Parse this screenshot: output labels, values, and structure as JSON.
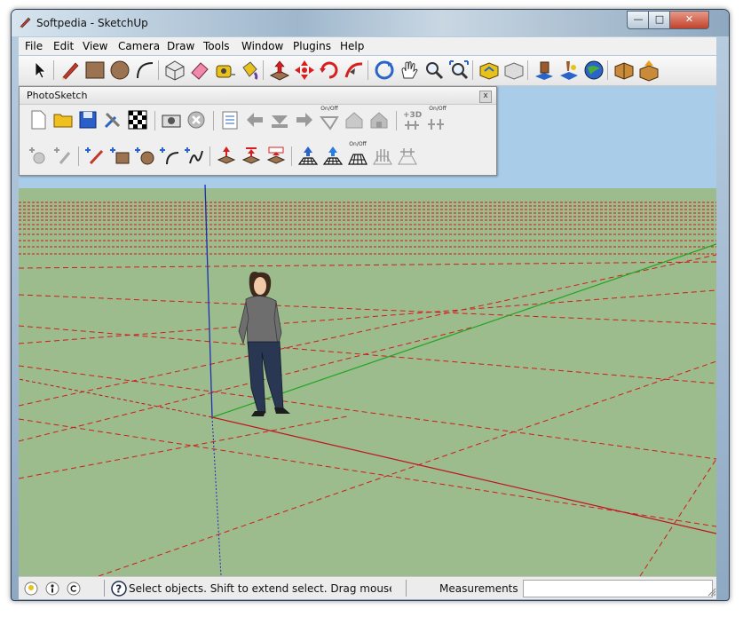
{
  "window": {
    "title": "Softpedia - SketchUp"
  },
  "menu": [
    "File",
    "Edit",
    "View",
    "Camera",
    "Draw",
    "Tools",
    "Window",
    "Plugins",
    "Help"
  ],
  "main_toolbar": [
    "select",
    "line",
    "rectangle",
    "circle",
    "arc",
    "make-component",
    "eraser",
    "tape-measure",
    "paint-bucket",
    "push-pull",
    "move",
    "rotate",
    "follow-me",
    "orbit",
    "pan",
    "zoom",
    "zoom-extents",
    "get-models",
    "share-model",
    "component",
    "add-location",
    "google-earth",
    "get-photo-texture",
    "upload"
  ],
  "photosketch": {
    "title": "PhotoSketch",
    "close_glyph": "x",
    "onoff_label": "On/Off",
    "plus3d_label": "+3D"
  },
  "status": {
    "text": "Select objects. Shift to extend select. Drag mouse t",
    "measurements_label": "Measurements",
    "measurements_value": ""
  },
  "colors": {
    "sky": "#a9cce8",
    "ground": "#9cbc8e",
    "axis_red": "#c1121f",
    "axis_green": "#1fa51f",
    "axis_blue": "#1d2fb0",
    "grid_red": "#e01010"
  }
}
